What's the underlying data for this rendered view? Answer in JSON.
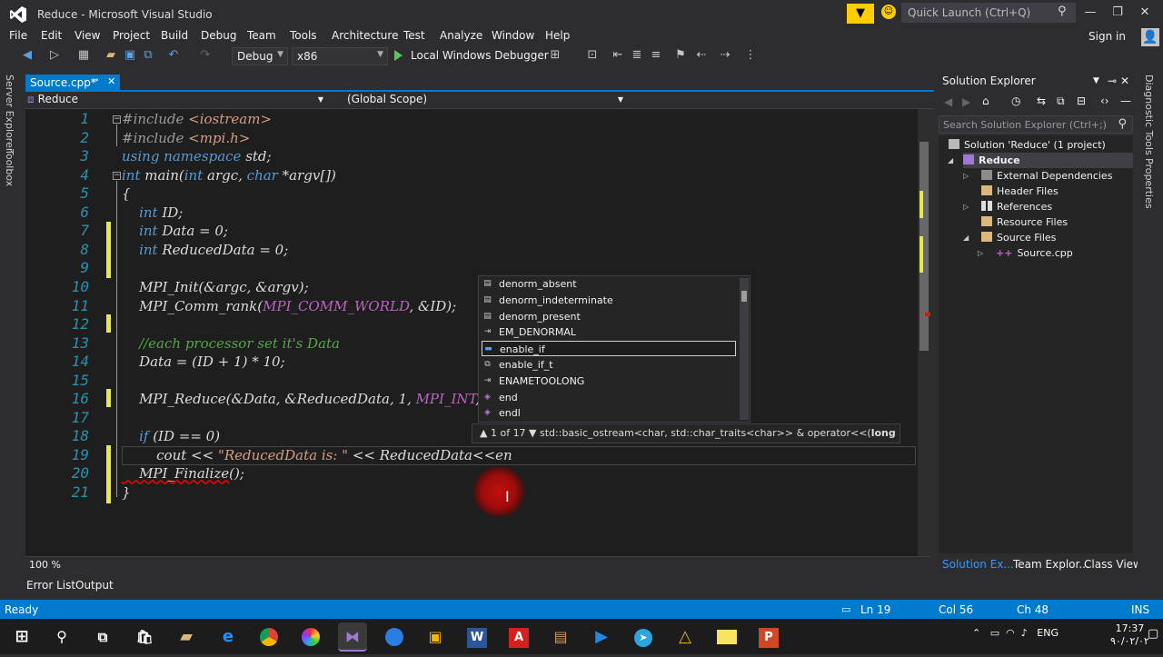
{
  "window": {
    "title": "Reduce - Microsoft Visual Studio",
    "quick_launch_placeholder": "Quick Launch (Ctrl+Q)",
    "signin": "Sign in"
  },
  "menu": [
    "File",
    "Edit",
    "View",
    "Project",
    "Build",
    "Debug",
    "Team",
    "Tools",
    "Architecture",
    "Test",
    "Analyze",
    "Window",
    "Help"
  ],
  "toolbar": {
    "config": "Debug",
    "platform": "x86",
    "debugger": "Local Windows Debugger"
  },
  "side_tabs": {
    "left": [
      "Server Explorer",
      "Toolbox"
    ],
    "right": [
      "Diagnostic Tools",
      "Properties"
    ]
  },
  "editor": {
    "tab": "Source.cpp*",
    "project_combo": "Reduce",
    "scope_combo": "(Global Scope)",
    "zoom": "100 %",
    "line_numbers": [
      "1",
      "2",
      "3",
      "4",
      "5",
      "6",
      "7",
      "8",
      "9",
      "10",
      "11",
      "12",
      "13",
      "14",
      "15",
      "16",
      "17",
      "18",
      "19",
      "20",
      "21"
    ],
    "lines": [
      {
        "parts": [
          {
            "c": "pp",
            "t": "#include "
          },
          {
            "c": "inc",
            "t": "<iostream>"
          }
        ]
      },
      {
        "parts": [
          {
            "c": "pp",
            "t": "#include "
          },
          {
            "c": "inc",
            "t": "<mpi.h>"
          }
        ]
      },
      {
        "parts": [
          {
            "c": "kw",
            "t": "using namespace "
          },
          {
            "c": "",
            "t": "std;"
          }
        ]
      },
      {
        "parts": [
          {
            "c": "kw",
            "t": "int "
          },
          {
            "c": "",
            "t": "main("
          },
          {
            "c": "kw",
            "t": "int "
          },
          {
            "c": "",
            "t": "argc, "
          },
          {
            "c": "kw",
            "t": "char "
          },
          {
            "c": "",
            "t": "*argv[])"
          }
        ]
      },
      {
        "parts": [
          {
            "c": "",
            "t": "{"
          }
        ]
      },
      {
        "parts": [
          {
            "c": "kw",
            "t": "    int "
          },
          {
            "c": "",
            "t": "ID;"
          }
        ]
      },
      {
        "parts": [
          {
            "c": "kw",
            "t": "    int "
          },
          {
            "c": "",
            "t": "Data = 0;"
          }
        ]
      },
      {
        "parts": [
          {
            "c": "kw",
            "t": "    int "
          },
          {
            "c": "",
            "t": "ReducedData = 0;"
          }
        ]
      },
      {
        "parts": [
          {
            "c": "",
            "t": ""
          }
        ]
      },
      {
        "parts": [
          {
            "c": "",
            "t": "    MPI_Init(&argc, &argv);"
          }
        ]
      },
      {
        "parts": [
          {
            "c": "",
            "t": "    MPI_Comm_rank("
          },
          {
            "c": "mac",
            "t": "MPI_COMM_WORLD"
          },
          {
            "c": "",
            "t": ", &ID);"
          }
        ]
      },
      {
        "parts": [
          {
            "c": "",
            "t": ""
          }
        ]
      },
      {
        "parts": [
          {
            "c": "cm",
            "t": "    //each processor set it's Data"
          }
        ]
      },
      {
        "parts": [
          {
            "c": "",
            "t": "    Data = (ID + 1) * 10;"
          }
        ]
      },
      {
        "parts": [
          {
            "c": "",
            "t": ""
          }
        ]
      },
      {
        "parts": [
          {
            "c": "",
            "t": "    MPI_Reduce(&Data, &ReducedData, 1, "
          },
          {
            "c": "mac",
            "t": "MPI_INT"
          },
          {
            "c": "",
            "t": ", /"
          }
        ]
      },
      {
        "parts": [
          {
            "c": "",
            "t": ""
          }
        ]
      },
      {
        "parts": [
          {
            "c": "kw",
            "t": "    if "
          },
          {
            "c": "",
            "t": "(ID == 0)"
          }
        ]
      },
      {
        "parts": [
          {
            "c": "",
            "t": "        cout << "
          },
          {
            "c": "str",
            "t": "\"ReducedData is: \""
          },
          {
            "c": "",
            "t": " << ReducedData<<en"
          }
        ]
      },
      {
        "parts": [
          {
            "c": "sq",
            "t": "    MPI_Finalize"
          },
          {
            "c": "",
            "t": "();"
          }
        ]
      },
      {
        "parts": [
          {
            "c": "",
            "t": "}"
          }
        ]
      }
    ]
  },
  "autocomplete": {
    "items": [
      {
        "label": "denorm_absent",
        "icon": "enum-icon"
      },
      {
        "label": "denorm_indeterminate",
        "icon": "enum-icon"
      },
      {
        "label": "denorm_present",
        "icon": "enum-icon"
      },
      {
        "label": "EM_DENORMAL",
        "icon": "macro-icon"
      },
      {
        "label": "enable_if",
        "icon": "struct-icon"
      },
      {
        "label": "enable_if_t",
        "icon": "typedef-icon"
      },
      {
        "label": "ENAMETOOLONG",
        "icon": "macro-icon"
      },
      {
        "label": "end",
        "icon": "function-icon"
      },
      {
        "label": "endl",
        "icon": "function-icon"
      }
    ],
    "selected": "enable_if",
    "signature_counter": "1 of 17",
    "signature_text": "std::basic_ostream<char, std::char_traits<char>> & operator<<(",
    "signature_param": "long long _Val)"
  },
  "solution_explorer": {
    "title": "Solution Explorer",
    "search_placeholder": "Search Solution Explorer (Ctrl+;)",
    "tree": [
      {
        "label": "Solution 'Reduce' (1 project)",
        "depth": 0
      },
      {
        "label": "Reduce",
        "depth": 1
      },
      {
        "label": "External Dependencies",
        "depth": 2
      },
      {
        "label": "Header Files",
        "depth": 2
      },
      {
        "label": "References",
        "depth": 2
      },
      {
        "label": "Resource Files",
        "depth": 2
      },
      {
        "label": "Source Files",
        "depth": 2
      },
      {
        "label": "Source.cpp",
        "depth": 3
      }
    ],
    "tabs": [
      "Solution Ex...",
      "Team Explor...",
      "Class View"
    ]
  },
  "bottom_tabs": [
    "Error List",
    "Output"
  ],
  "status": {
    "ready": "Ready",
    "ln": "Ln 19",
    "col": "Col 56",
    "ch": "Ch 48",
    "ins": "INS"
  },
  "taskbar": {
    "lang": "ENG",
    "time": "17:37",
    "date": "۹۰/۰۲/۰۲"
  },
  "colors": {
    "accent": "#007acc",
    "editor_bg": "#1e1e1e",
    "keyword": "#569cd6",
    "comment": "#57a64a",
    "macro": "#bd63c5"
  }
}
